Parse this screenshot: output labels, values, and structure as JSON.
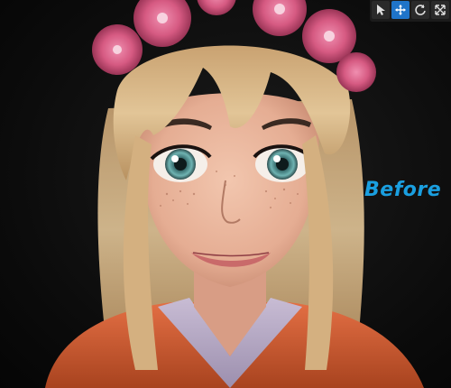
{
  "viewport": {
    "overlay_label": "Before",
    "overlay_label_color": "#1a9fe0"
  },
  "toolbar": {
    "tools": [
      {
        "icon": "select-cursor-icon",
        "active": false
      },
      {
        "icon": "move-icon",
        "active": true
      },
      {
        "icon": "rotate-icon",
        "active": false
      },
      {
        "icon": "scale-icon",
        "active": false
      }
    ],
    "active_color": "#1f74c9"
  },
  "colors": {
    "background": "#0d0d0d",
    "hair": "#d9b98a",
    "skin": "#e9b79f",
    "eyes": "#5fa7a8",
    "flowers": "#d9577f",
    "jacket": "#d9653a",
    "shirt": "#b7aac6"
  }
}
